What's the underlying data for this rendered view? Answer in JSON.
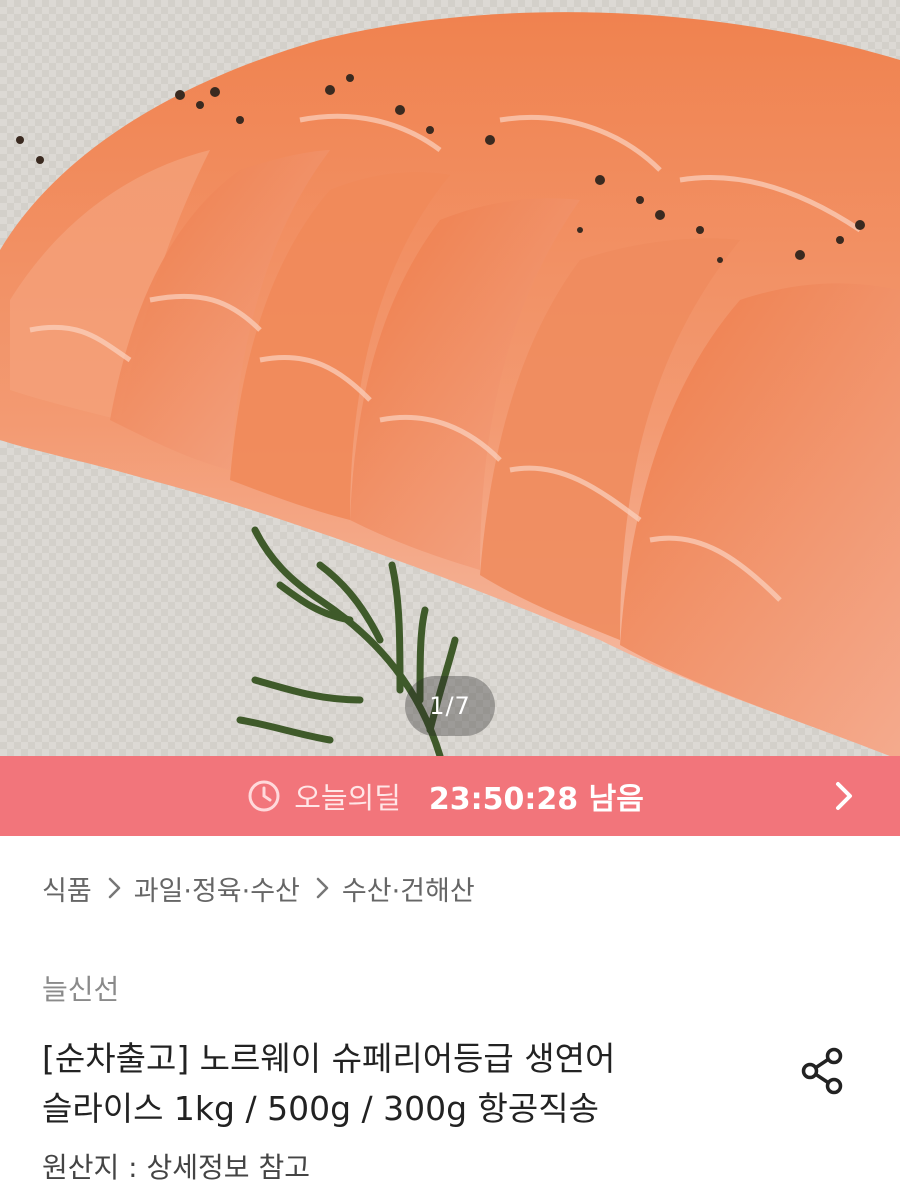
{
  "gallery": {
    "pager": "1/7"
  },
  "deal": {
    "label": "오늘의딜",
    "timer": "23:50:28 남음",
    "color": "#f2757b",
    "icons": [
      "clock-icon",
      "chevron-right-icon"
    ]
  },
  "breadcrumb": {
    "items": [
      "식품",
      "과일·정육·수산",
      "수산·건해산"
    ],
    "separator_icon": "chevron-right-icon"
  },
  "product": {
    "seller": "늘신선",
    "title_line1": "[순차출고] 노르웨이 슈페리어등급 생연어",
    "title_line2": "슬라이스 1kg / 500g / 300g 항공직송",
    "origin": "원산지 : 상세정보 참고",
    "share_icon": "share-icon"
  }
}
